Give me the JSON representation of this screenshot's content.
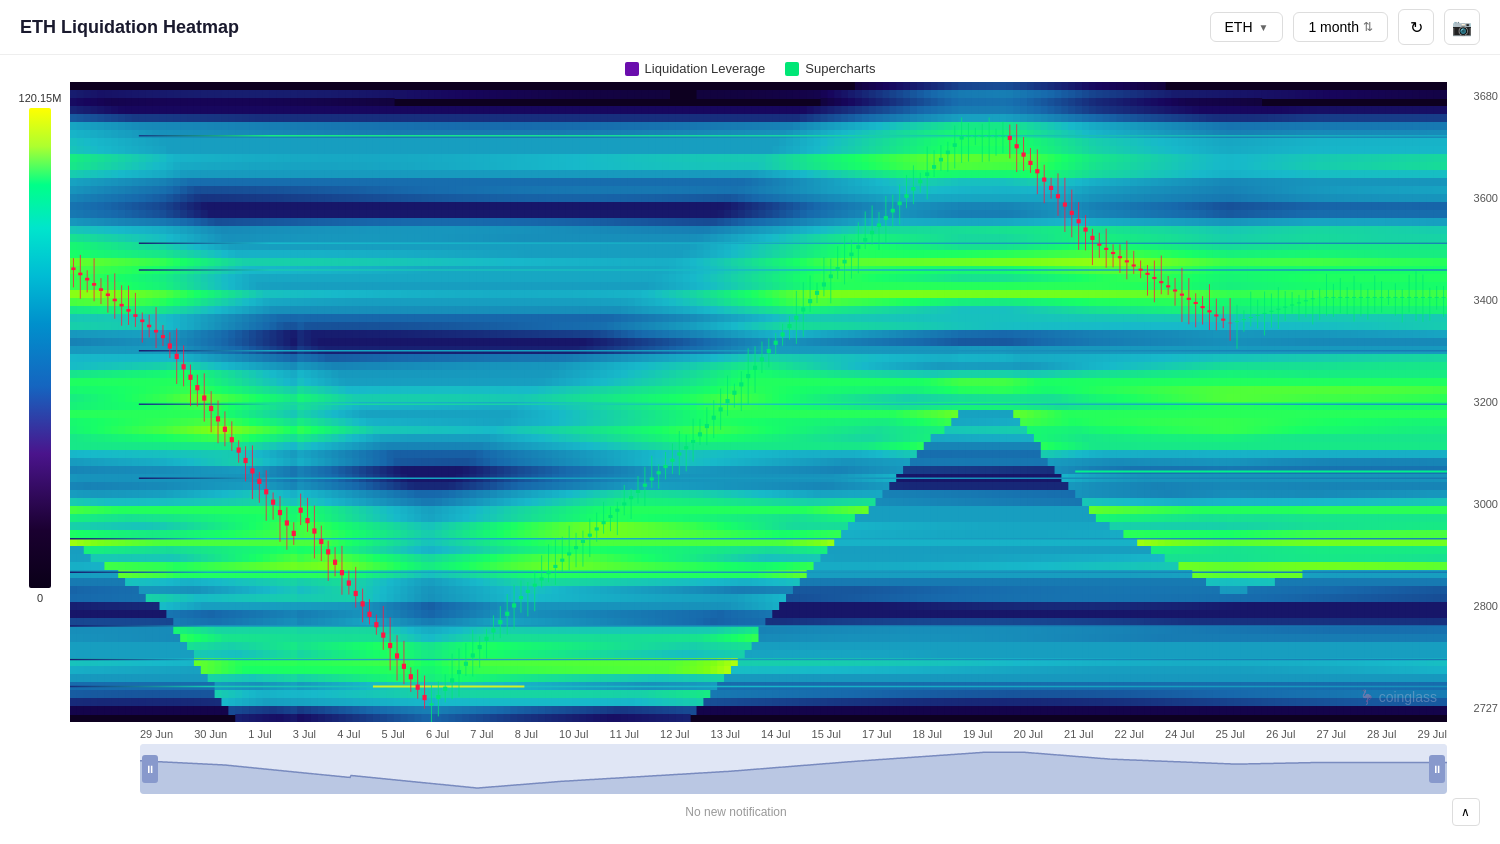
{
  "header": {
    "title": "ETH Liquidation Heatmap",
    "asset_dropdown": "ETH",
    "time_dropdown": "1 month",
    "refresh_icon": "↻",
    "camera_icon": "📷"
  },
  "legend": {
    "items": [
      {
        "label": "Liquidation Leverage",
        "color": "#6a0dad"
      },
      {
        "label": "Supercharts",
        "color": "#00e676"
      }
    ]
  },
  "color_scale": {
    "max_label": "120.15M",
    "min_label": "0"
  },
  "price_axis": {
    "labels": [
      "3680",
      "3600",
      "3400",
      "3200",
      "3000",
      "2800",
      "2727"
    ]
  },
  "time_axis": {
    "labels": [
      "29 Jun",
      "30 Jun",
      "1 Jul",
      "3 Jul",
      "4 Jul",
      "5 Jul",
      "6 Jul",
      "7 Jul",
      "8 Jul",
      "10 Jul",
      "11 Jul",
      "12 Jul",
      "13 Jul",
      "14 Jul",
      "15 Jul",
      "17 Jul",
      "18 Jul",
      "19 Jul",
      "20 Jul",
      "21 Jul",
      "22 Jul",
      "24 Jul",
      "25 Jul",
      "26 Jul",
      "27 Jul",
      "28 Jul",
      "29 Jul"
    ]
  },
  "watermark": {
    "text": "coinglass"
  },
  "notification": {
    "text": "No new notification"
  },
  "colors": {
    "background_dark": "#0d0020",
    "heatmap_bg": "#0d0020",
    "accent_teal": "#00bcd4",
    "accent_green": "#00e676"
  }
}
